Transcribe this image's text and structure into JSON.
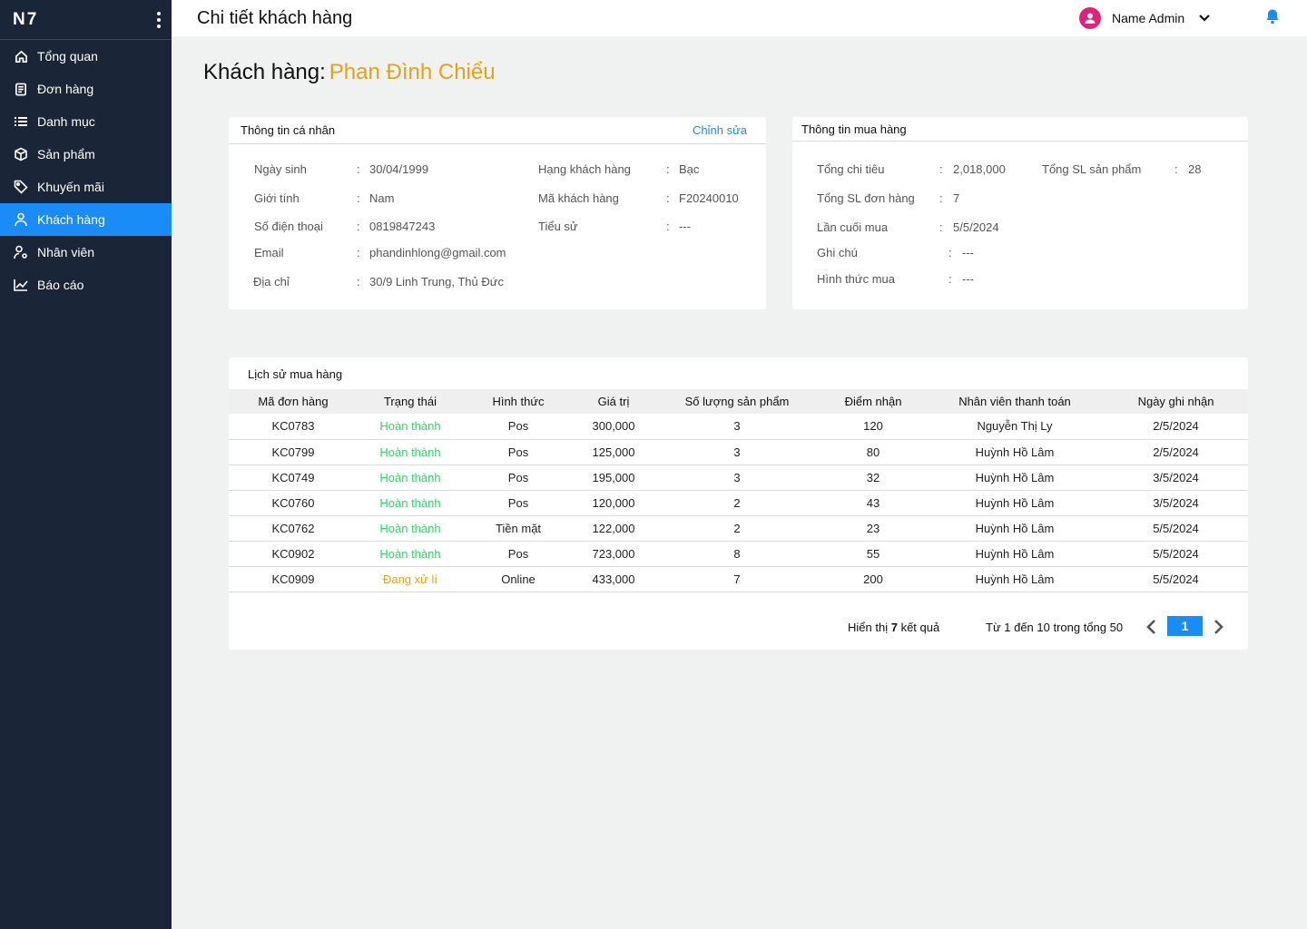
{
  "app": {
    "logo": "N7"
  },
  "sidebar": {
    "items": [
      {
        "label": "Tổng quan",
        "icon": "home-icon"
      },
      {
        "label": "Đơn hàng",
        "icon": "document-icon"
      },
      {
        "label": "Danh mục",
        "icon": "list-icon"
      },
      {
        "label": "Sản phẩm",
        "icon": "box-icon"
      },
      {
        "label": "Khuyến mãi",
        "icon": "tag-icon"
      },
      {
        "label": "Khách hàng",
        "icon": "user-icon",
        "active": true
      },
      {
        "label": "Nhân viên",
        "icon": "user-settings-icon"
      },
      {
        "label": "Báo cáo",
        "icon": "chart-line-icon"
      }
    ]
  },
  "header": {
    "title": "Chi tiết khách hàng",
    "user_name": "Name Admin"
  },
  "customer": {
    "label": "Khách hàng:",
    "name": "Phan Đình Chiểu"
  },
  "personal": {
    "title": "Thông tin cá nhân",
    "edit_label": "Chỉnh sửa",
    "birthday_label": "Ngày sinh",
    "birthday": "30/04/1999",
    "gender_label": "Giới tính",
    "gender": "Nam",
    "phone_label": "Số điện thoại",
    "phone": "0819847243",
    "email_label": "Email",
    "email": "phandinhlong@gmail.com",
    "address_label": "Địa chỉ",
    "address": "30/9 Linh Trung, Thủ Đức",
    "rank_label": "Hạng khách hàng",
    "rank": "Bạc",
    "code_label": "Mã khách hàng",
    "code": "F20240010",
    "bio_label": "Tiểu sử",
    "bio": "---",
    "sep": ":"
  },
  "purchase": {
    "title": "Thông tin mua hàng",
    "total_spend_label": "Tổng chi tiêu",
    "total_spend": "2,018,000",
    "total_products_label": "Tổng SL sản phẩm",
    "total_products": "28",
    "total_orders_label": "Tổng SL đơn hàng",
    "total_orders": "7",
    "last_purchase_label": "Lần cuối mua",
    "last_purchase": "5/5/2024",
    "note_label": "Ghi chú",
    "note": "---",
    "method_label": "Hình thức mua",
    "method": "---"
  },
  "history": {
    "title": "Lịch sử mua hàng",
    "columns": [
      "Mã đơn hàng",
      "Trạng thái",
      "Hình thức",
      "Giá trị",
      "Số lượng sản phẩm",
      "Điểm nhận",
      "Nhân viên thanh toán",
      "Ngày ghi nhận"
    ],
    "rows": [
      [
        "KC0783",
        "Hoàn thành",
        "Pos",
        "300,000",
        "3",
        "120",
        "Nguyễn Thị Ly",
        "2/5/2024"
      ],
      [
        "KC0799",
        "Hoàn thành",
        "Pos",
        "125,000",
        "3",
        "80",
        "Huỳnh Hồ Lâm",
        "2/5/2024"
      ],
      [
        "KC0749",
        "Hoàn thành",
        "Pos",
        "195,000",
        "3",
        "32",
        "Huỳnh Hồ Lâm",
        "3/5/2024"
      ],
      [
        "KC0760",
        "Hoàn thành",
        "Pos",
        "120,000",
        "2",
        "43",
        "Huỳnh Hồ Lâm",
        "3/5/2024"
      ],
      [
        "KC0762",
        "Hoàn thành",
        "Tiền mặt",
        "122,000",
        "2",
        "23",
        "Huỳnh Hồ Lâm",
        "5/5/2024"
      ],
      [
        "KC0902",
        "Hoàn thành",
        "Pos",
        "723,000",
        "8",
        "55",
        "Huỳnh Hồ Lâm",
        "5/5/2024"
      ],
      [
        "KC0909",
        "Đang xử lí",
        "Online",
        "433,000",
        "7",
        "200",
        "Huỳnh Hồ Lâm",
        "5/5/2024"
      ]
    ],
    "showing_prefix": "Hiển thị",
    "showing_count": "7",
    "showing_suffix": "kết quả",
    "range_text": "Từ 1 đến 10 trong tổng 50",
    "current_page": "1"
  },
  "colors": {
    "sidebar_bg": "#1b2538",
    "accent": "#1a8cf8",
    "done": "#37d36a",
    "pending": "#e5a117",
    "avatar": "#e0217a"
  }
}
